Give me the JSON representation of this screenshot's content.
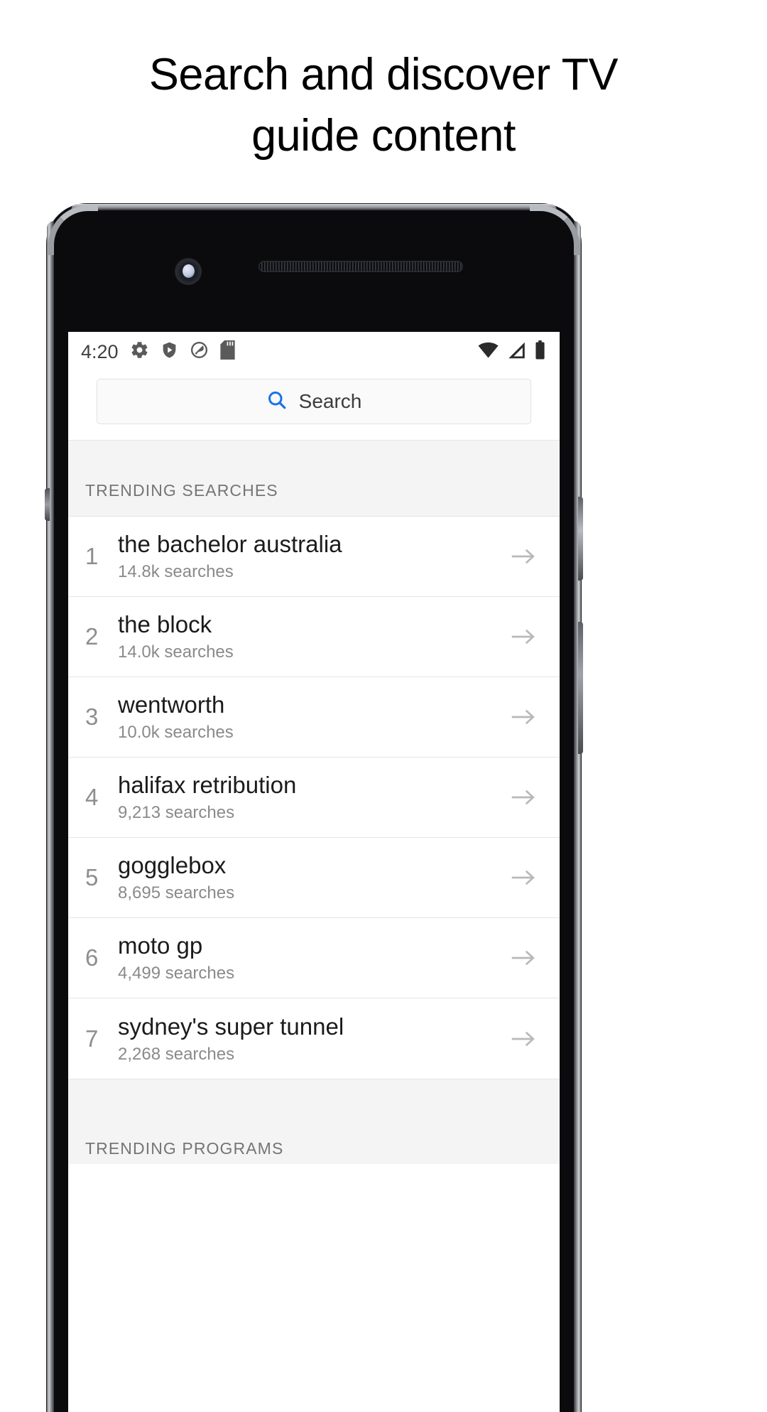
{
  "promo": {
    "headline_line1": "Search and discover TV",
    "headline_line2": "guide content"
  },
  "colors": {
    "accent_blue": "#1a73e8",
    "band_gray": "#f4f4f4",
    "muted_text": "#8a8a8a",
    "screen_white": "#ffffff"
  },
  "status_bar": {
    "time": "4:20",
    "left_icons": [
      "gear-icon",
      "shield-play-icon",
      "circle-slash-icon",
      "sd-card-icon"
    ],
    "right_icons": [
      "wifi-icon",
      "signal-icon",
      "battery-icon"
    ]
  },
  "search": {
    "icon": "search-icon",
    "placeholder": "Search",
    "value": ""
  },
  "sections": {
    "trending_searches_label": "TRENDING SEARCHES",
    "trending_programs_label": "TRENDING PROGRAMS"
  },
  "trending_searches": [
    {
      "rank": "1",
      "title": "the bachelor australia",
      "subtitle": "14.8k searches",
      "arrow": "arrow-right-icon"
    },
    {
      "rank": "2",
      "title": "the block",
      "subtitle": "14.0k searches",
      "arrow": "arrow-right-icon"
    },
    {
      "rank": "3",
      "title": "wentworth",
      "subtitle": "10.0k searches",
      "arrow": "arrow-right-icon"
    },
    {
      "rank": "4",
      "title": "halifax retribution",
      "subtitle": "9,213 searches",
      "arrow": "arrow-right-icon"
    },
    {
      "rank": "5",
      "title": "gogglebox",
      "subtitle": "8,695 searches",
      "arrow": "arrow-right-icon"
    },
    {
      "rank": "6",
      "title": "moto gp",
      "subtitle": "4,499 searches",
      "arrow": "arrow-right-icon"
    },
    {
      "rank": "7",
      "title": "sydney's super tunnel",
      "subtitle": "2,268 searches",
      "arrow": "arrow-right-icon"
    }
  ]
}
